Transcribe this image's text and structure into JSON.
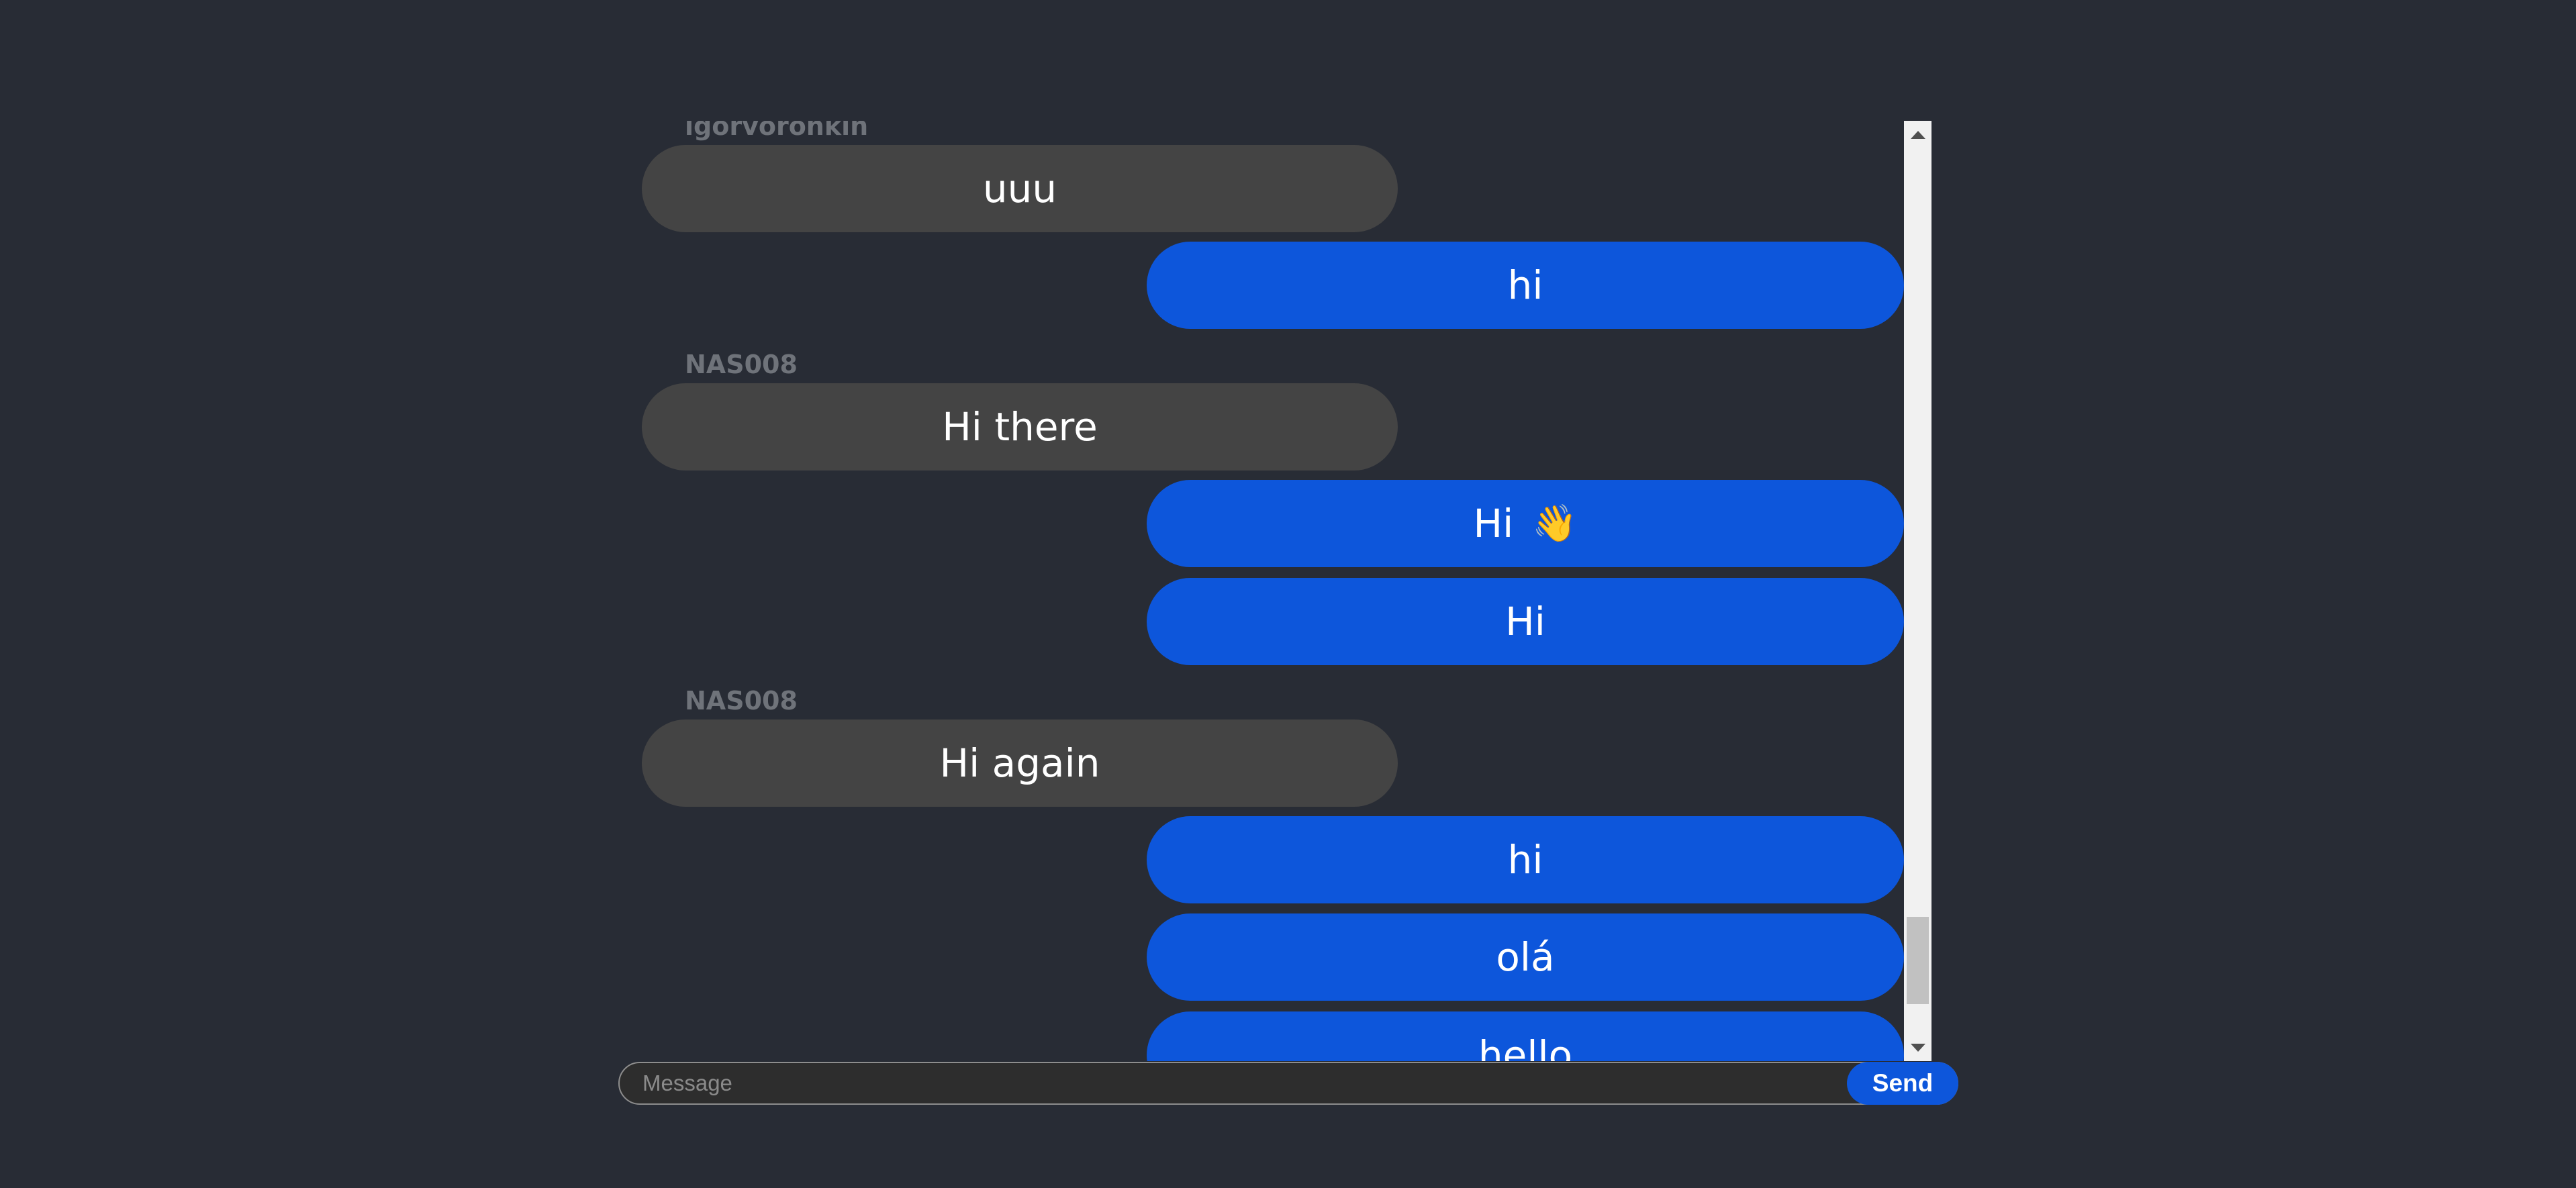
{
  "messages": [
    {
      "sender": "igorvoronkin",
      "text": "uuu",
      "from": "other"
    },
    {
      "text": "hi",
      "from": "self"
    },
    {
      "sender": "NAS008",
      "text": "Hi there",
      "from": "other"
    },
    {
      "text": "Hi",
      "emoji": "👋",
      "icon": "waving-hand-icon",
      "from": "self"
    },
    {
      "text": "Hi",
      "from": "self"
    },
    {
      "sender": "NAS008",
      "text": "Hi again",
      "from": "other"
    },
    {
      "text": "hi",
      "from": "self"
    },
    {
      "text": "olá",
      "from": "self"
    },
    {
      "text": "hello",
      "from": "self"
    }
  ],
  "composer": {
    "placeholder": "Message",
    "value": "",
    "send_label": "Send"
  },
  "colors": {
    "background": "#282c35",
    "own_bubble": "#0d56db",
    "other_bubble": "#444444",
    "sender_name": "#6f737a"
  }
}
